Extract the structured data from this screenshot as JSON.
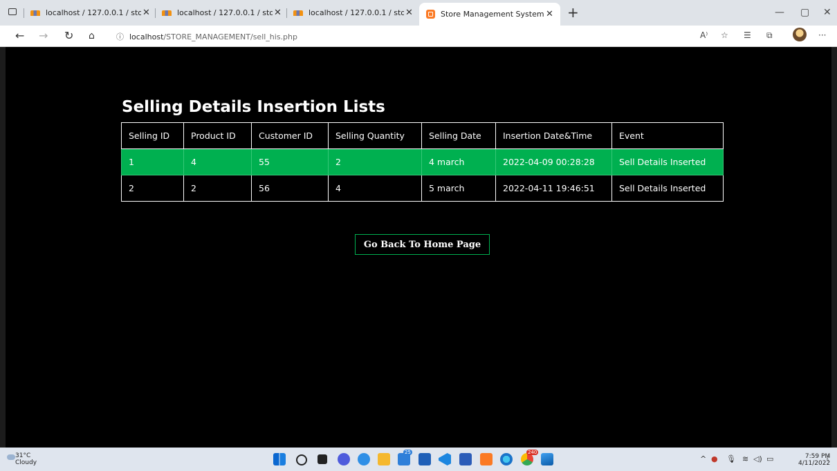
{
  "browser": {
    "tabs": [
      {
        "title": "localhost / 127.0.0.1 / store_man",
        "favicon": "phpmyadmin-icon"
      },
      {
        "title": "localhost / 127.0.0.1 / store_man",
        "favicon": "phpmyadmin-icon"
      },
      {
        "title": "localhost / 127.0.0.1 / store_man",
        "favicon": "phpmyadmin-icon"
      },
      {
        "title": "Store Management System",
        "favicon": "xampp-icon",
        "active": true
      }
    ],
    "url_host": "localhost",
    "url_path": "/STORE_MANAGEMENT/sell_his.php"
  },
  "page": {
    "title": "Selling Details Insertion Lists",
    "columns": [
      "Selling ID",
      "Product ID",
      "Customer ID",
      "Selling Quantity",
      "Selling Date",
      "Insertion Date&Time",
      "Event"
    ],
    "rows": [
      [
        "1",
        "4",
        "55",
        "2",
        "4 march",
        "2022-04-09 00:28:28",
        "Sell Details Inserted"
      ],
      [
        "2",
        "2",
        "56",
        "4",
        "5 march",
        "2022-04-11 19:46:51",
        "Sell Details Inserted"
      ]
    ],
    "back_button": "Go Back To Home Page",
    "accent_color": "#00b050"
  },
  "taskbar": {
    "weather_temp": "31°C",
    "weather_desc": "Cloudy",
    "time": "7:59 PM",
    "date": "4/11/2022",
    "badges": {
      "store": "25",
      "chrome": "240"
    }
  }
}
